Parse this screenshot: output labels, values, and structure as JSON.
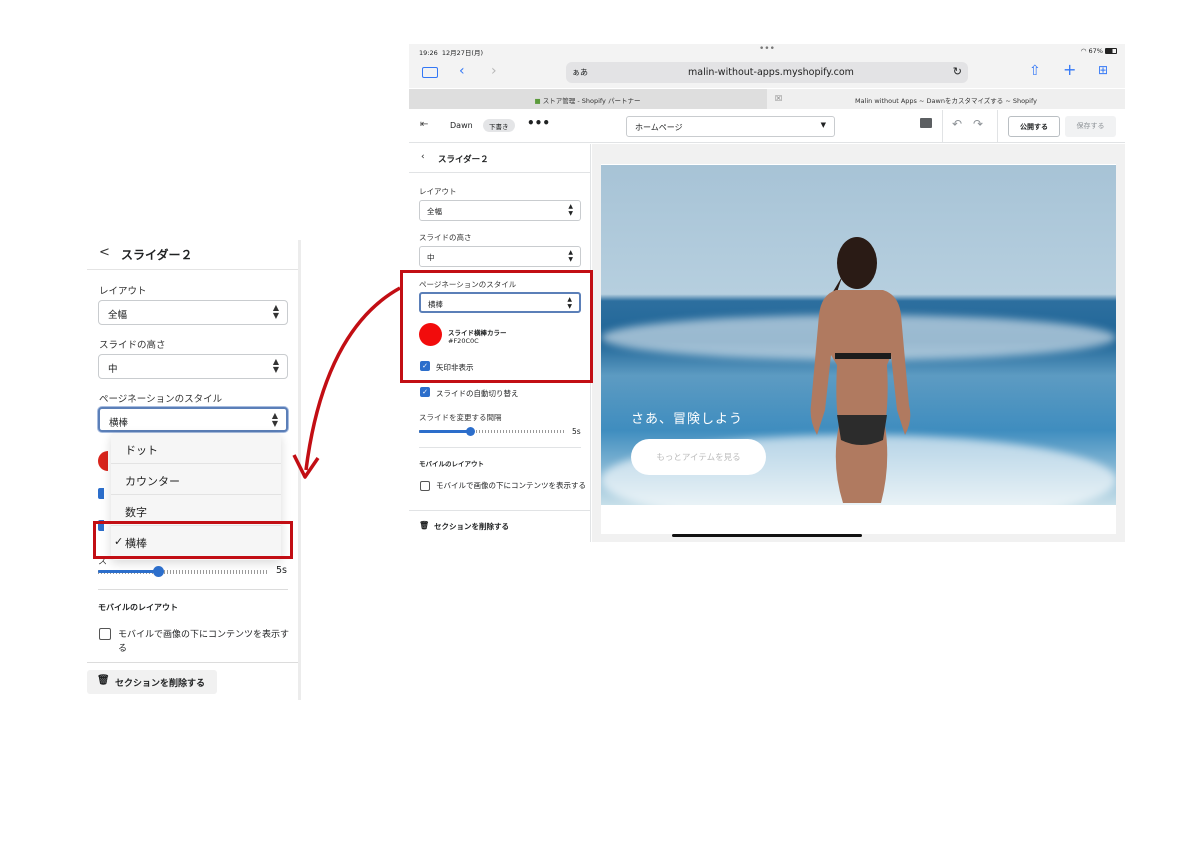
{
  "zoom_panel": {
    "back_symbol": "<",
    "title": "スライダー２",
    "layout_label": "レイアウト",
    "layout_value": "全幅",
    "slide_height_label": "スライドの高さ",
    "slide_height_value": "中",
    "pagination_label": "ページネーションのスタイル",
    "pagination_value": "横棒",
    "dropdown_options": [
      {
        "label": "ドット",
        "selected": false
      },
      {
        "label": "カウンター",
        "selected": false
      },
      {
        "label": "数字",
        "selected": false
      },
      {
        "label": "横棒",
        "selected": true
      }
    ],
    "check_mark": "✓",
    "slider_value": "5s",
    "slider_fraction": 0.35,
    "mobile_layout_heading": "モバイルのレイアウト",
    "mobile_checkbox_label": "モバイルで画像の下にコンテンツを表示する",
    "delete_section": "セクションを削除する",
    "partial_glyph": "ス"
  },
  "ipad": {
    "status": {
      "time": "19:26",
      "date": "12月27日(月)",
      "dots": "•••",
      "battery": "67%"
    },
    "browser": {
      "aa": "ぁあ",
      "url": "malin-without-apps.myshopify.com",
      "tabs": [
        {
          "label": "ストア管理 - Shopify パートナー",
          "active": false
        },
        {
          "label": "Malin without Apps ~ Dawnをカスタマイズする ~ Shopify",
          "active": true
        }
      ]
    },
    "toolbar": {
      "theme_name": "Dawn",
      "draft_badge": "下書き",
      "more": "•••",
      "page_select": "ホームページ",
      "publish": "公開する",
      "save": "保存する"
    },
    "sidebar": {
      "title": "スライダー２",
      "layout_label": "レイアウト",
      "layout_value": "全幅",
      "slide_height_label": "スライドの高さ",
      "slide_height_value": "中",
      "pagination_label": "ページネーションのスタイル",
      "pagination_value": "横棒",
      "color_label": "スライド横棒カラー",
      "color_hex": "#F20C0C",
      "swatch_color": "#F20C0C",
      "hide_arrows": "矢印非表示",
      "autoplay": "スライドの自動切り替え",
      "interval_label": "スライドを変更する間隔",
      "interval_value": "5s",
      "interval_fraction": 0.35,
      "mobile_layout_heading": "モバイルのレイアウト",
      "mobile_checkbox_label": "モバイルで画像の下にコンテンツを表示する",
      "delete_section": "セクションを削除する"
    },
    "preview": {
      "hero_text": "さあ、冒険しよう",
      "hero_button": "もっとアイテムを見る"
    }
  },
  "colors": {
    "accent": "#2C6ECB",
    "highlight_red": "#C20E14",
    "swatch_red": "#F20C0C"
  }
}
